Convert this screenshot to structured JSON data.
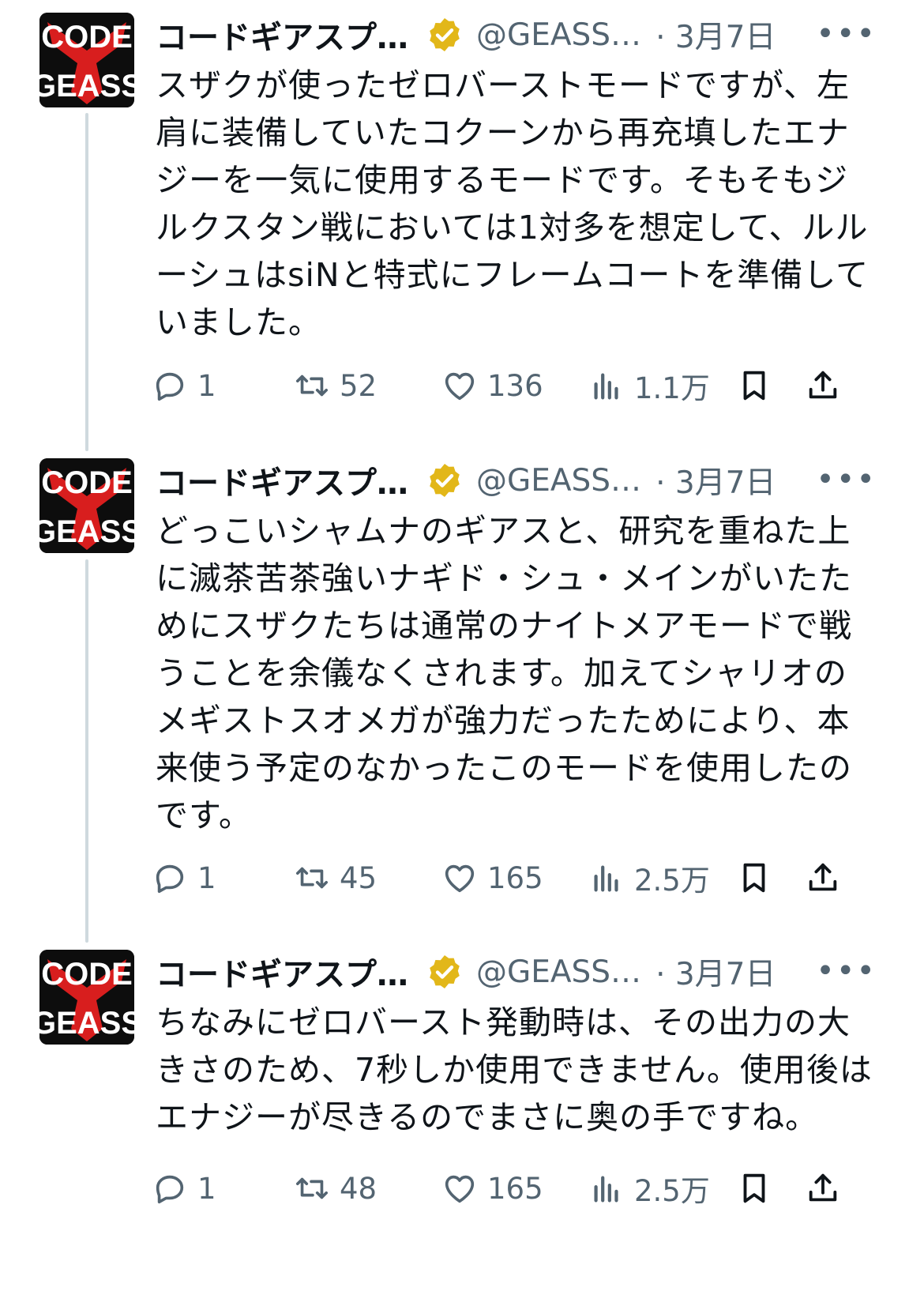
{
  "tweets": [
    {
      "name": "コードギアスプ…",
      "handle": "@GEASS…",
      "date": "· 3月7日",
      "more": "•••",
      "lines": [
        "スザクが使ったゼロバーストモードですが、左",
        "肩に装備していたコクーンから再充填したエナ",
        "ジーを一気に使用するモードです。そもそもジ",
        "ルクスタン戦においては1対多を想定して、ルル",
        "ーシュはsiNと特式にフレームコートを準備して",
        "いました。"
      ],
      "replies": "1",
      "retweets": "52",
      "likes": "136",
      "views": "1.1万"
    },
    {
      "name": "コードギアスプ…",
      "handle": "@GEASS…",
      "date": "· 3月7日",
      "more": "•••",
      "lines": [
        "どっこいシャムナのギアスと、研究を重ねた上",
        "に滅茶苦茶強いナギド・シュ・メインがいたた",
        "めにスザクたちは通常のナイトメアモードで戦",
        "うことを余儀なくされます。加えてシャリオの",
        "メギストスオメガが強力だったためにより、本",
        "来使う予定のなかったこのモードを使用したの",
        "です。"
      ],
      "replies": "1",
      "retweets": "45",
      "likes": "165",
      "views": "2.5万"
    },
    {
      "name": "コードギアスプ…",
      "handle": "@GEASS…",
      "date": "· 3月7日",
      "more": "•••",
      "lines": [
        "ちなみにゼロバースト発動時は、その出力の大",
        "きさのため、7秒しか使用できません。使用後は",
        "エナジーが尽きるのでまさに奥の手ですね。"
      ],
      "replies": "1",
      "retweets": "48",
      "likes": "165",
      "views": "2.5万"
    }
  ],
  "icons": {
    "avatar": "code-geass-logo",
    "badge": "verified-gold-badge",
    "reply": "reply-bubble-icon",
    "retweet": "retweet-icon",
    "like": "heart-icon",
    "views": "views-bar-icon",
    "bookmark": "bookmark-icon",
    "share": "share-icon"
  },
  "colors": {
    "text": "#0f1419",
    "secondary": "#536471",
    "thread_line": "#cfd9de",
    "badge_gold": "#e2b719"
  }
}
